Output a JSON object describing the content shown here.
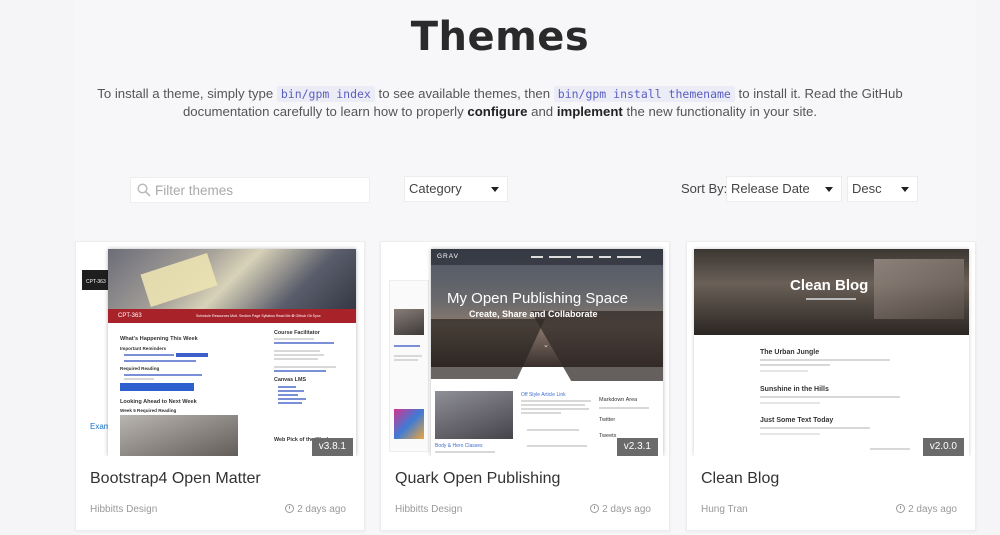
{
  "page": {
    "title": "Themes",
    "intro": {
      "part1": "To install a theme, simply type",
      "code1": "bin/gpm index",
      "part2": "to see available themes, then",
      "code2": "bin/gpm install themename",
      "part3": "to install it. Read the GitHub",
      "part4": "documentation carefully to learn how to properly",
      "bold1": "configure",
      "part5": "and",
      "bold2": "implement",
      "part6": "the new functionality in your site."
    }
  },
  "filters": {
    "search_placeholder": "Filter themes",
    "category": "Category",
    "sort_label": "Sort By:",
    "sort_value": "Release Date",
    "order_value": "Desc"
  },
  "themes": [
    {
      "name": "Bootstrap4 Open Matter",
      "author": "Hibbitts Design",
      "age": "2 days ago",
      "version": "v3.8.1",
      "preview": {
        "brand": "CPT-363",
        "nav": "Schedule  Resources  Mult. Section Page  Syllabus  Read Me  ✪ Github Git Sync",
        "week_title": "What's Happening This Week",
        "reminders": "Important Reminders",
        "reading": "Required Reading",
        "next_week": "Looking Ahead to Next Week",
        "week5": "Week 5 Required Reading",
        "facilitator": "Course Facilitator",
        "canvas": "Canvas LMS",
        "web_pick": "Web Pick of the Week",
        "side_label": "Examp"
      }
    },
    {
      "name": "Quark Open Publishing",
      "author": "Hibbitts Design",
      "age": "2 days ago",
      "version": "v2.3.1",
      "preview": {
        "logo": "GRAV",
        "hero_title": "My Open Publishing Space",
        "hero_sub": "Create, Share and Collaborate",
        "markdown": "Markdown Area",
        "twitter": "Twitter",
        "tweets": "Tweets",
        "card1": "Body & Hero Classes",
        "card2": "Off Style Article Link"
      }
    },
    {
      "name": "Clean Blog",
      "author": "Hung Tran",
      "age": "2 days ago",
      "version": "v2.0.0",
      "preview": {
        "hero_title": "Clean Blog",
        "post1": "The Urban Jungle",
        "post2": "Sunshine in the Hills",
        "post3": "Just Some Text Today"
      }
    }
  ],
  "colors": {
    "accent": "#5a5fc0",
    "badge": "#6a6a6a",
    "bootstrap_red": "#a8222a"
  }
}
